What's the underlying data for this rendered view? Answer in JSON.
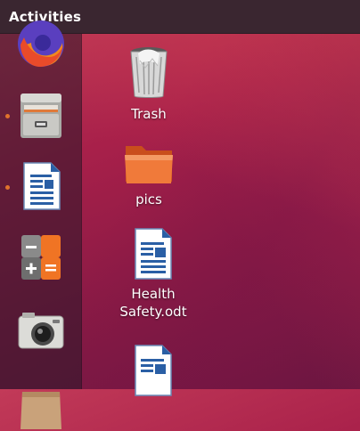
{
  "topbar": {
    "activities_label": "Activities"
  },
  "dock": {
    "items": [
      {
        "name": "Firefox",
        "icon": "firefox-icon",
        "running": false
      },
      {
        "name": "Files",
        "icon": "file-cabinet-icon",
        "running": true
      },
      {
        "name": "LibreOffice Writer",
        "icon": "writer-document-icon",
        "running": true
      },
      {
        "name": "Calculator",
        "icon": "calculator-icon",
        "running": false
      },
      {
        "name": "Cheese",
        "icon": "camera-icon",
        "running": false
      },
      {
        "name": "Software",
        "icon": "shopping-bag-icon",
        "running": false
      }
    ],
    "running_dot_color": "#e0732c"
  },
  "desktop": {
    "icons": [
      {
        "label": "Trash",
        "icon": "trash-icon"
      },
      {
        "label": "pics",
        "icon": "folder-icon"
      },
      {
        "label": "Health\nSafety.odt",
        "line1": "Health",
        "line2": "Safety.odt",
        "icon": "writer-document-icon"
      },
      {
        "label": "",
        "icon": "writer-document-icon"
      }
    ]
  },
  "colors": {
    "topbar": "#3a2630",
    "accent": "#e95420",
    "background": "#a8204a"
  }
}
